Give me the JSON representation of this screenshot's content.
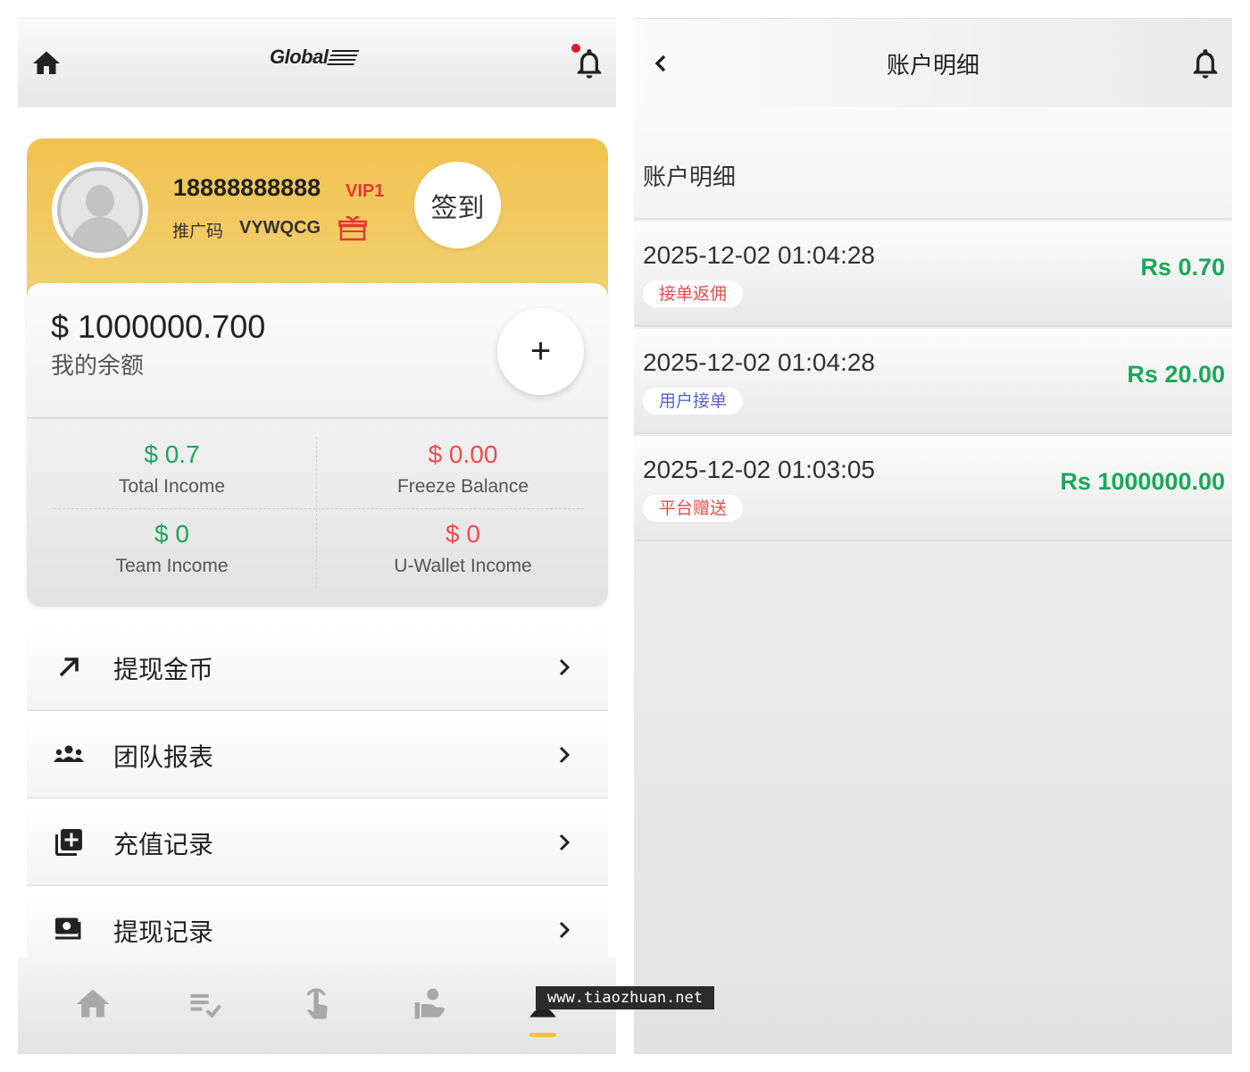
{
  "left": {
    "header": {
      "logo": "Global"
    },
    "profile": {
      "phone": "18888888888",
      "vip": "VIP1",
      "invite_label": "推广码",
      "invite_code": "VYWQCG",
      "signin_label": "签到"
    },
    "balance": {
      "amount": "$ 1000000.700",
      "label": "我的余额",
      "plus_label": "+"
    },
    "stats": [
      {
        "value": "$ 0.7",
        "label": "Total Income"
      },
      {
        "value": "$ 0.00",
        "label": "Freeze Balance"
      },
      {
        "value": "$ 0",
        "label": "Team Income"
      },
      {
        "value": "$ 0",
        "label": "U-Wallet Income"
      }
    ],
    "menu": [
      {
        "label": "提现金币",
        "icon": "arrow-up-right-icon"
      },
      {
        "label": "团队报表",
        "icon": "team-icon"
      },
      {
        "label": "充值记录",
        "icon": "add-box-icon"
      },
      {
        "label": "提现记录",
        "icon": "cash-icon"
      }
    ],
    "bottom_nav": [
      "home-icon",
      "task-list-icon",
      "tap-icon",
      "hand-coin-icon",
      "profile-icon"
    ]
  },
  "right": {
    "title": "账户明细",
    "section_title": "账户明细",
    "transactions": [
      {
        "time": "2025-12-02 01:04:28",
        "tag": "接单返佣",
        "amount": "Rs 0.70"
      },
      {
        "time": "2025-12-02 01:04:28",
        "tag": "用户接单",
        "amount": "Rs 20.00"
      },
      {
        "time": "2025-12-02 01:03:05",
        "tag": "平台赠送",
        "amount": "Rs 1000000.00"
      }
    ]
  },
  "watermark": "www.tiaozhuan.net",
  "colors": {
    "accent_yellow": "#f0c24f",
    "income_green": "#1aa85b",
    "alert_red": "#ef4b4b",
    "tag_blue": "#5b63c9"
  }
}
